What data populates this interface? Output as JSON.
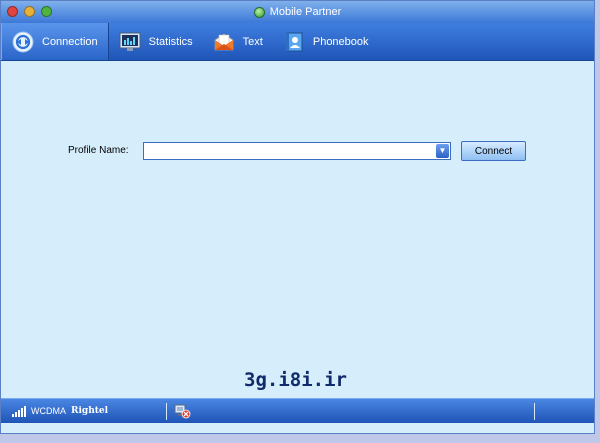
{
  "window": {
    "title": "Mobile Partner"
  },
  "toolbar": {
    "tabs": [
      {
        "label": "Connection",
        "icon": "connection-icon",
        "active": true
      },
      {
        "label": "Statistics",
        "icon": "statistics-icon",
        "active": false
      },
      {
        "label": "Text",
        "icon": "text-message-icon",
        "active": false
      },
      {
        "label": "Phonebook",
        "icon": "phonebook-icon",
        "active": false
      }
    ]
  },
  "connection": {
    "profile_label": "Profile Name:",
    "profile_value": "",
    "connect_label": "Connect"
  },
  "watermark": "3g.i8i.ir",
  "statusbar": {
    "network_type": "WCDMA",
    "operator": "Rightel"
  },
  "colors": {
    "titlebar": "#3c78d8",
    "toolbar": "#1f56b8",
    "content_bg": "#d6eefb",
    "close_button": "#e0443d",
    "minimize_button": "#e8b13a",
    "zoom_button": "#4fb33e"
  }
}
